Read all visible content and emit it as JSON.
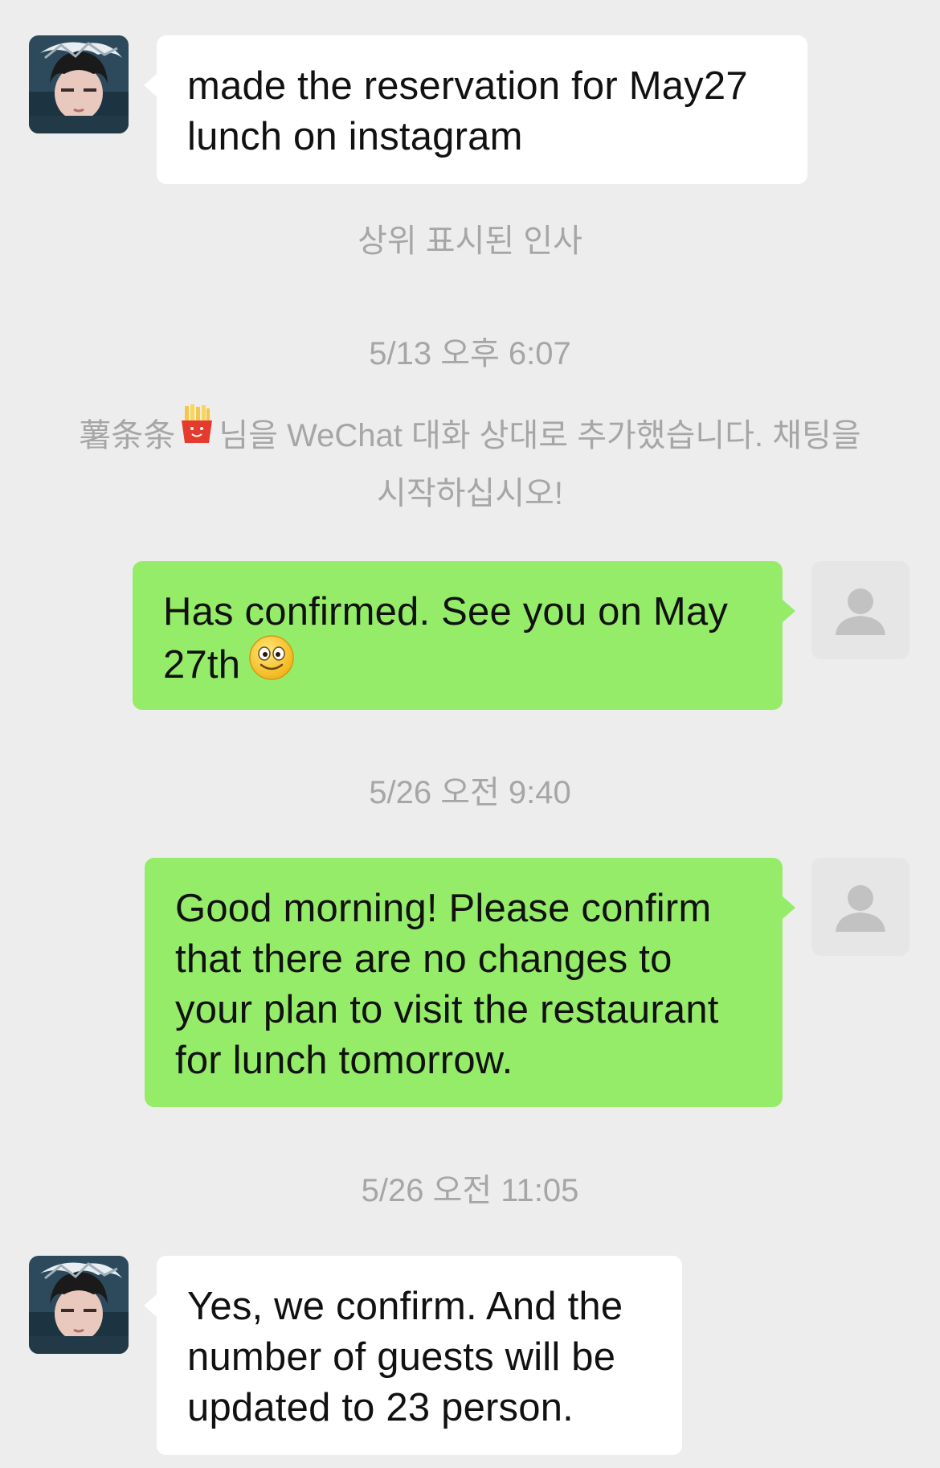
{
  "messages": [
    {
      "sender": "contact",
      "text": "made the reservation for May27 lunch on instagram"
    },
    {
      "sender": "me",
      "text": "Has confirmed. See you on May 27th",
      "emoji": "smiling-face-emoji"
    },
    {
      "sender": "me",
      "text": "Good morning! Please confirm that there are no changes to your plan to visit the restaurant for lunch tomorrow."
    },
    {
      "sender": "contact",
      "text": "Yes, we confirm. And the number of guests will be updated to 23 person."
    }
  ],
  "system": {
    "greeting_notice": "상위 표시된 인사",
    "timestamp_1": "5/13 오후 6:07",
    "added_contact_name": "薯条条",
    "added_contact_emoji": "french-fries-emoji",
    "added_notice_line1_rest": "님을 WeChat 대화 상대로 추가했습니다. 채팅을",
    "added_notice_line2": "시작하십시오!",
    "timestamp_2": "5/26 오전 9:40",
    "timestamp_3": "5/26 오전 11:05"
  },
  "colors": {
    "background": "#ededed",
    "incoming_bubble": "#ffffff",
    "outgoing_bubble": "#95ec69",
    "system_text": "#a6a6a6"
  }
}
